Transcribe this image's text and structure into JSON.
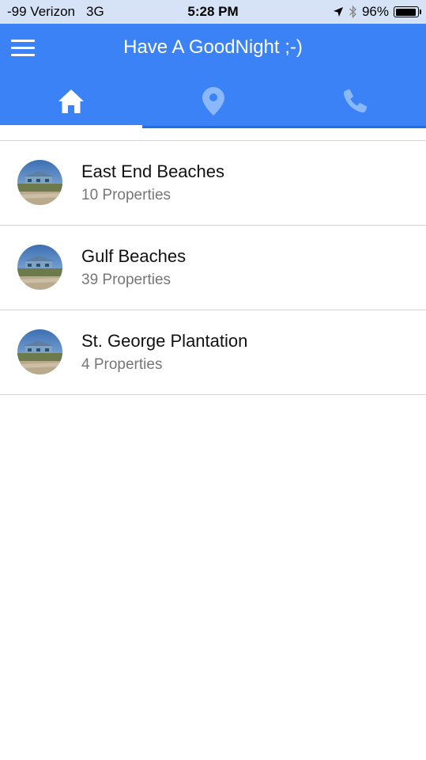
{
  "status_bar": {
    "carrier": "-99 Verizon",
    "network": "3G",
    "time": "5:28 PM",
    "battery": "96%",
    "battery_level": 0.96,
    "icons": [
      "location-arrow-icon",
      "bluetooth-icon",
      "battery-icon"
    ]
  },
  "header": {
    "title": "Have A GoodNight ;-)",
    "menu_icon": "hamburger-menu-icon",
    "background_color": "#3a82f6"
  },
  "tabs": [
    {
      "icon": "home-icon",
      "active": true
    },
    {
      "icon": "map-pin-icon",
      "active": false
    },
    {
      "icon": "phone-icon",
      "active": false
    }
  ],
  "list": {
    "items": [
      {
        "title": "East End Beaches",
        "subtitle": "10 Properties",
        "avatar": "beach-house-photo"
      },
      {
        "title": "Gulf Beaches",
        "subtitle": "39 Properties",
        "avatar": "beach-house-photo"
      },
      {
        "title": "St. George Plantation",
        "subtitle": "4 Properties",
        "avatar": "beach-house-photo"
      }
    ]
  }
}
